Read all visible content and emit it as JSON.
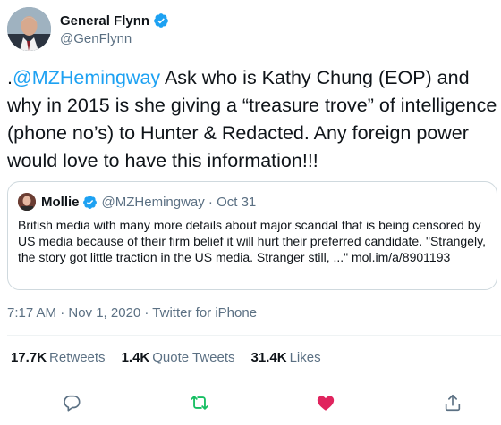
{
  "author": {
    "display_name": "General Flynn",
    "handle": "@GenFlynn",
    "avatar_icon": "profile-photo",
    "verified_icon": "verified-badge-icon"
  },
  "tweet": {
    "prefix": ".",
    "mention": "@MZHemingway",
    "text": " Ask who is Kathy Chung (EOP) and why in 2015 is she giving a “treasure trove” of intelligence (phone no’s) to Hunter & Redacted. Any foreign power would love to have this information!!!"
  },
  "quoted_tweet": {
    "display_name": "Mollie",
    "handle_and_date": "@MZHemingway · Oct 31",
    "text": "British media with many more details about major scandal that is being censored by US media because of their firm belief it will hurt their preferred candidate. \"Strangely, the story got little traction in the US media.  Stranger still, ...\" mol.im/a/8901193"
  },
  "meta": {
    "timestamp": "7:17 AM · Nov 1, 2020 · Twitter for iPhone"
  },
  "stats": {
    "retweets_count": "17.7K",
    "retweets_label": "Retweets",
    "quotes_count": "1.4K",
    "quotes_label": "Quote Tweets",
    "likes_count": "31.4K",
    "likes_label": "Likes"
  },
  "colors": {
    "link": "#1da1f2",
    "retweet_active": "#17bf63",
    "like_active": "#e0245e",
    "secondary_text": "#5b7083"
  }
}
